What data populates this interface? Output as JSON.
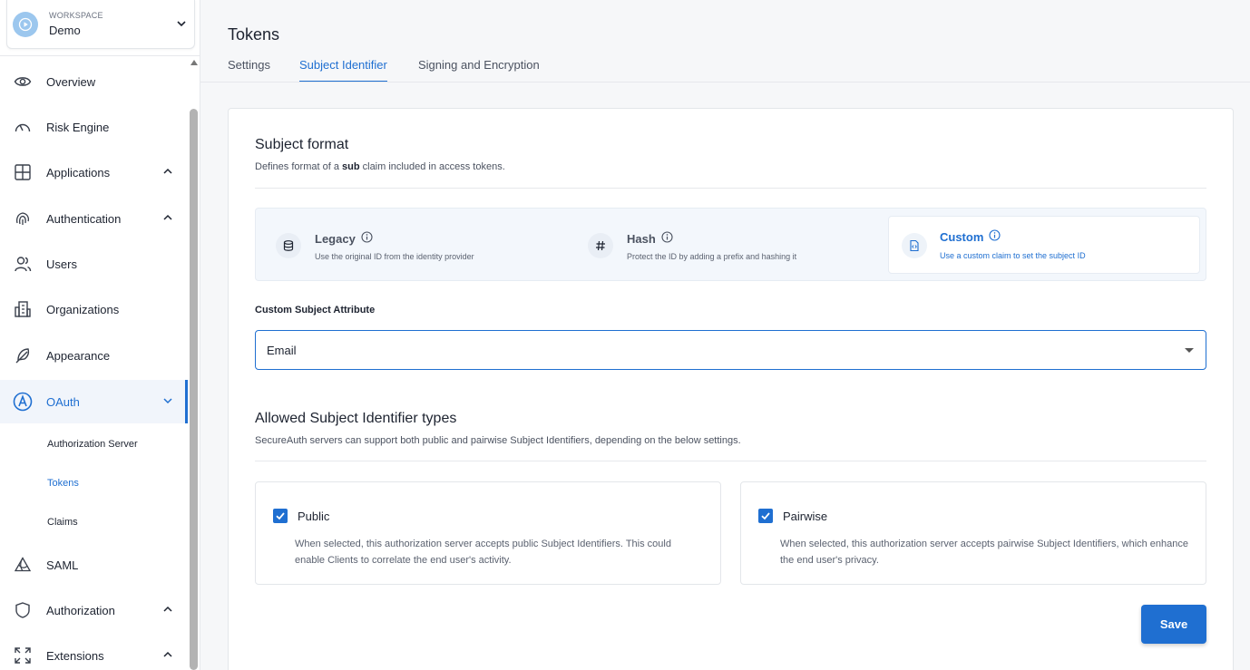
{
  "workspace": {
    "label": "WORKSPACE",
    "name": "Demo"
  },
  "sidebar": {
    "items": [
      {
        "label": "Overview",
        "icon": "eye-icon"
      },
      {
        "label": "Risk Engine",
        "icon": "gauge-icon"
      },
      {
        "label": "Applications",
        "icon": "grid-icon"
      },
      {
        "label": "Authentication",
        "icon": "fingerprint-icon"
      },
      {
        "label": "Users",
        "icon": "users-icon"
      },
      {
        "label": "Organizations",
        "icon": "building-icon"
      },
      {
        "label": "Appearance",
        "icon": "feather-icon"
      },
      {
        "label": "OAuth",
        "icon": "oauth-icon"
      },
      {
        "label": "SAML",
        "icon": "saml-icon"
      },
      {
        "label": "Authorization",
        "icon": "shield-icon"
      },
      {
        "label": "Extensions",
        "icon": "expand-icon"
      }
    ],
    "oauth_sub": [
      "Authorization Server",
      "Tokens",
      "Claims"
    ]
  },
  "page": {
    "title": "Tokens",
    "tabs": [
      "Settings",
      "Subject Identifier",
      "Signing and Encryption"
    ]
  },
  "subject_format": {
    "title": "Subject format",
    "desc_before": "Defines format of a ",
    "desc_bold": "sub",
    "desc_after": " claim included in access tokens.",
    "options": [
      {
        "name": "Legacy",
        "desc": "Use the original ID from the identity provider",
        "icon": "database-icon"
      },
      {
        "name": "Hash",
        "desc": "Protect the ID by adding a prefix and hashing it",
        "icon": "hash-icon"
      },
      {
        "name": "Custom",
        "desc": "Use a custom claim to set the subject ID",
        "icon": "file-code-icon"
      }
    ]
  },
  "custom_attribute": {
    "label": "Custom Subject Attribute",
    "value": "Email"
  },
  "allowed_types": {
    "title": "Allowed Subject Identifier types",
    "desc": "SecureAuth servers can support both public and pairwise Subject Identifiers, depending on the below settings.",
    "public": {
      "label": "Public",
      "checked": true,
      "desc": "When selected, this authorization server accepts public Subject Identifiers. This could enable Clients to correlate the end user's activity."
    },
    "pairwise": {
      "label": "Pairwise",
      "checked": true,
      "desc": "When selected, this authorization server accepts pairwise Subject Identifiers, which enhance the end user's privacy."
    }
  },
  "actions": {
    "save": "Save"
  },
  "colors": {
    "accent": "#1f6fd1",
    "text": "#1d2330",
    "muted": "#5b6270"
  }
}
